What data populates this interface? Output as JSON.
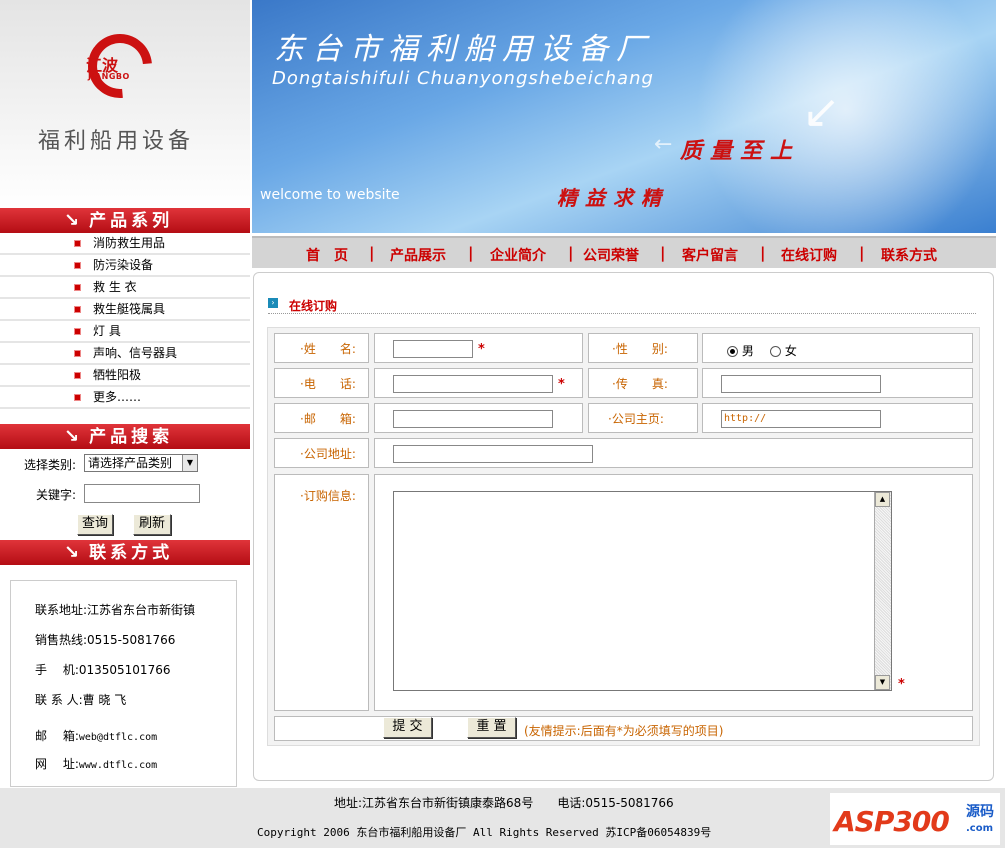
{
  "logo": {
    "cn": "江波",
    "en": "JIANGBO",
    "title": "福利船用设备"
  },
  "banner": {
    "title": "东台市福利船用设备厂",
    "subtitle": "Dongtaishifuli Chuanyongshebeichang",
    "slogan1": "质量至上",
    "slogan2": "精益求精",
    "welcome": "welcome to website"
  },
  "sidebar": {
    "products_title": "产品系列",
    "products": [
      "消防救生用品",
      "防污染设备",
      "救 生 衣",
      "救生艇筏属具",
      "灯 具",
      "声响、信号器具",
      "牺牲阳极",
      "更多……"
    ],
    "search_title": "产品搜索",
    "search": {
      "category_label": "选择类别:",
      "category_value": "请选择产品类别",
      "keyword_label": "关键字:",
      "query_button": "查询",
      "refresh_button": "刷新"
    },
    "contact_title": "联系方式",
    "contact": {
      "address": "联系地址:江苏省东台市新街镇",
      "hotline": "销售热线:0515-5081766",
      "mobile": "手　 机:013505101766",
      "person": "联 系 人:曹 晓 飞",
      "email_label": "邮　 箱:",
      "email": "web@dtflc.com",
      "site_label": "网　 址:",
      "site": "www.dtflc.com"
    }
  },
  "nav": [
    "首　页",
    "产品展示",
    "企业简介",
    "公司荣誉",
    "客户留言",
    "在线订购",
    "联系方式"
  ],
  "nav_sep": "|",
  "form": {
    "section_title": "在线订购",
    "name_label": "·姓　　名:",
    "gender_label": "·性　　别:",
    "male": "男",
    "female": "女",
    "phone_label": "·电　　话:",
    "fax_label": "·传　　真:",
    "email_label": "·邮　　箱:",
    "homepage_label": "·公司主页:",
    "homepage_value": "http://",
    "address_label": "·公司地址:",
    "order_label": "·订购信息:",
    "required_mark": "*",
    "submit": "提 交",
    "reset": "重 置",
    "tip": "(友情提示:后面有*为必须填写的项目)"
  },
  "footer": {
    "address": "地址:江苏省东台市新街镇康泰路68号　　电话:0515-5081766",
    "copyright": "Copyright 2006 东台市福利船用设备厂 All Rights Reserved 苏ICP备06054839号"
  },
  "watermark": {
    "text": "ASP300",
    "sub": "源码",
    "com": ".com"
  }
}
